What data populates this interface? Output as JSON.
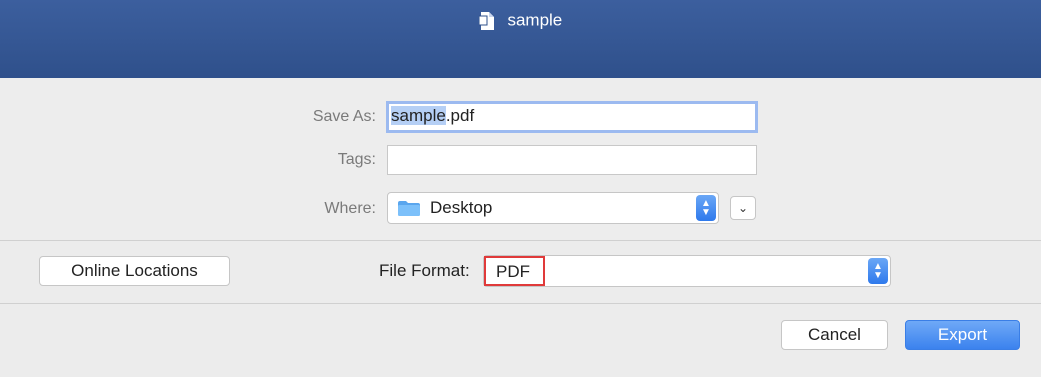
{
  "window": {
    "title": "sample",
    "title_icon": "document-icon"
  },
  "save_as": {
    "label": "Save As:",
    "value_selected": "sample",
    "value_rest": ".pdf"
  },
  "tags": {
    "label": "Tags:",
    "value": ""
  },
  "where": {
    "label": "Where:",
    "value": "Desktop",
    "icon": "folder-icon"
  },
  "online_locations": {
    "label": "Online Locations"
  },
  "file_format": {
    "label": "File Format:",
    "value": "PDF"
  },
  "actions": {
    "cancel_label": "Cancel",
    "export_label": "Export"
  },
  "colors": {
    "titlebar": "#2f508b",
    "accent": "#3b82ee",
    "highlight_box": "#e03a3a"
  }
}
